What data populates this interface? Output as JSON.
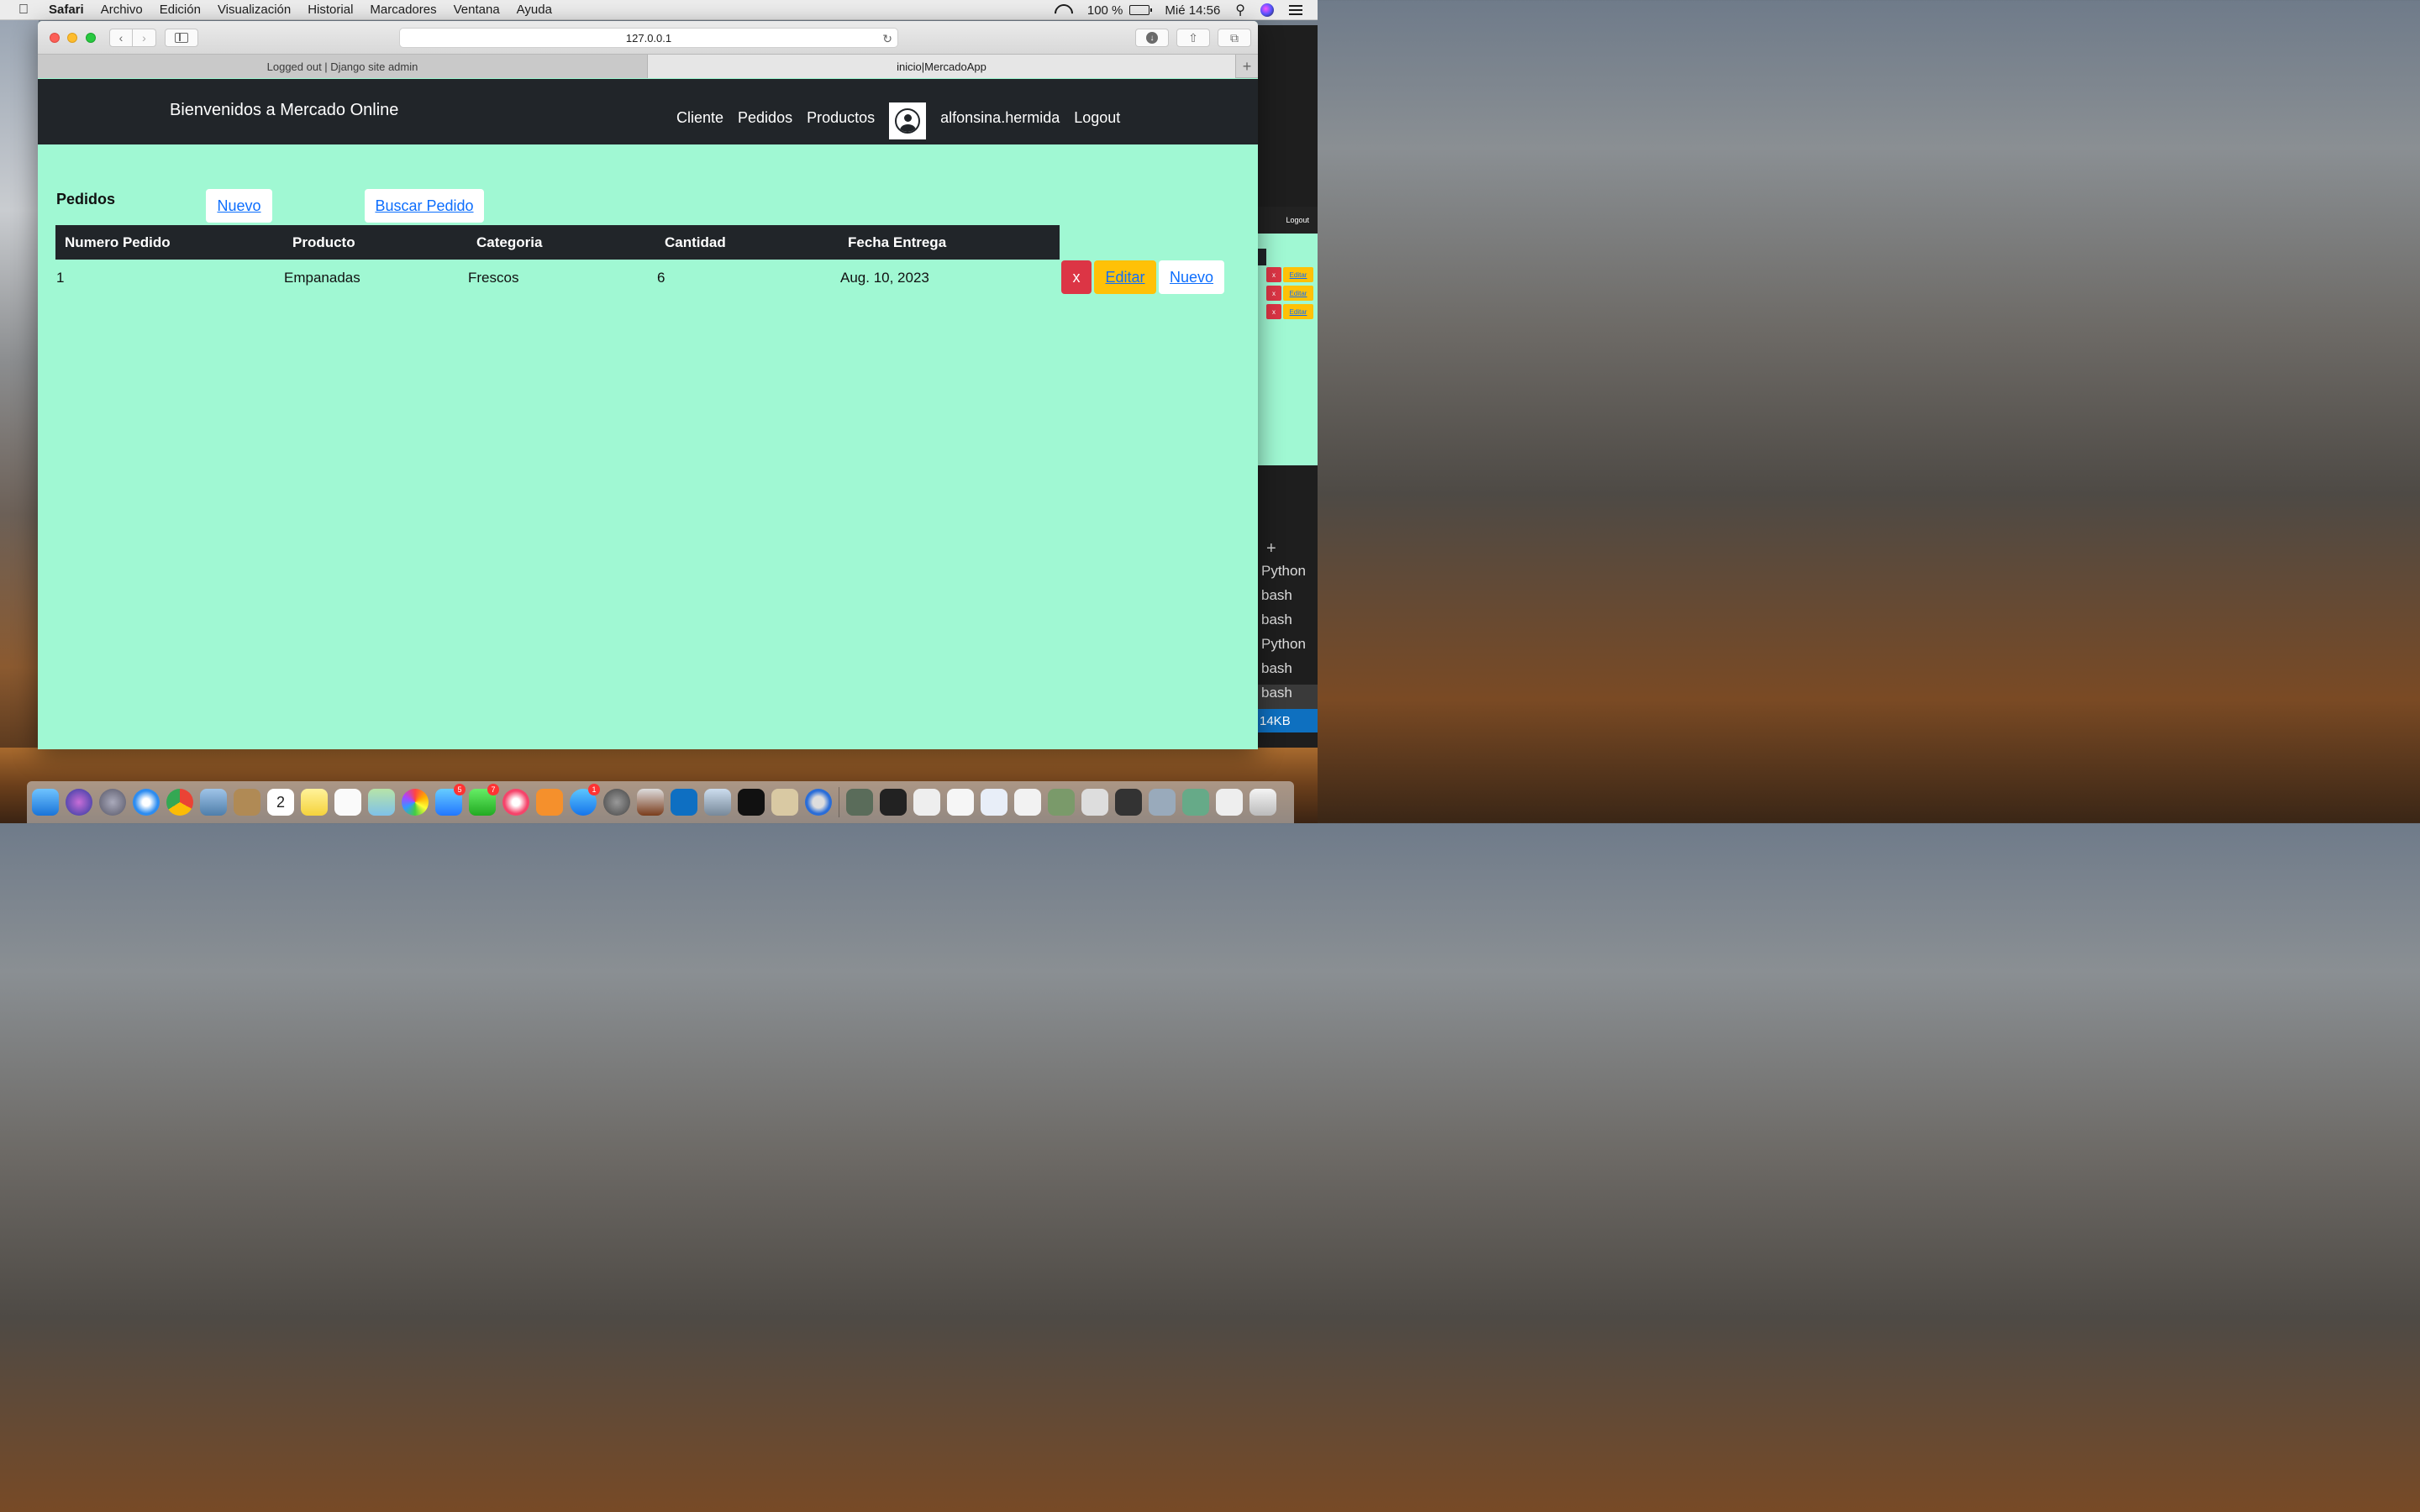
{
  "menubar": {
    "app": "Safari",
    "items": [
      "Archivo",
      "Edición",
      "Visualización",
      "Historial",
      "Marcadores",
      "Ventana",
      "Ayuda"
    ],
    "battery": "100 %",
    "clock": "Mié 14:56"
  },
  "browser": {
    "url": "127.0.0.1",
    "tabs": [
      {
        "title": "Logged out | Django site admin",
        "active": false
      },
      {
        "title": "inicio|MercadoApp",
        "active": true
      }
    ]
  },
  "navbar": {
    "brand": "Bienvenidos a Mercado Online",
    "links": [
      "Cliente",
      "Pedidos",
      "Productos"
    ],
    "username": "alfonsina.hermida",
    "logout": "Logout"
  },
  "main": {
    "title": "Pedidos",
    "new_button": "Nuevo",
    "search_button": "Buscar Pedido",
    "columns": [
      "Numero Pedido",
      "Producto",
      "Categoria",
      "Cantidad",
      "Fecha Entrega"
    ],
    "rows": [
      {
        "numero": "1",
        "producto": "Empanadas",
        "categoria": "Frescos",
        "cantidad": "6",
        "fecha": "Aug. 10, 2023"
      }
    ],
    "row_actions": {
      "delete": "x",
      "edit": "Editar",
      "new": "Nuevo"
    }
  },
  "background_window": {
    "logout": "Logout",
    "edit_label": "Editar",
    "delete_label": "x",
    "terminal_tabs": [
      "Python",
      "bash",
      "bash",
      "Python",
      "bash",
      "bash"
    ],
    "status": "14KB"
  },
  "dock": {
    "badges": {
      "messages": "5",
      "facetime": "7",
      "appstore": "1"
    },
    "calendar_day": "2"
  }
}
